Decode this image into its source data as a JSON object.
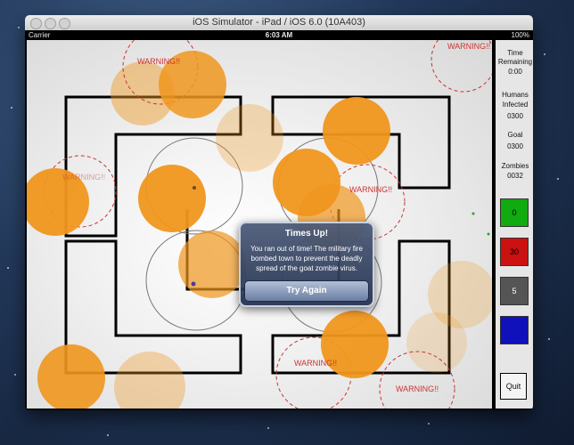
{
  "window": {
    "title": "iOS Simulator - iPad / iOS 6.0 (10A403)"
  },
  "status_bar": {
    "carrier": "Carrier",
    "time": "6:03 AM",
    "battery": "100%"
  },
  "game": {
    "warning_text": "WARNING!!"
  },
  "sidebar": {
    "time_label_1": "Time",
    "time_label_2": "Remaining",
    "time_value": "0:00",
    "humans_label_1": "Humans",
    "humans_label_2": "Infected",
    "humans_value": "0300",
    "goal_label": "Goal",
    "goal_value": "0300",
    "zombies_label": "Zombies",
    "zombies_value": "0032",
    "buttons": [
      {
        "label": "0",
        "color": "#11aa11"
      },
      {
        "label": "30",
        "color": "#cc1111"
      },
      {
        "label": "5",
        "color": "#555555"
      },
      {
        "label": "",
        "color": "#1111bb"
      }
    ],
    "quit_label": "Quit"
  },
  "alert": {
    "title": "Times Up!",
    "message": "You ran out of time! The military fire bombed town to prevent the deadly spread of the goat zombie virus.",
    "button_label": "Try Again"
  },
  "colors": {
    "zombie_orange": "#f0961e",
    "warning_red": "#cc3333"
  }
}
